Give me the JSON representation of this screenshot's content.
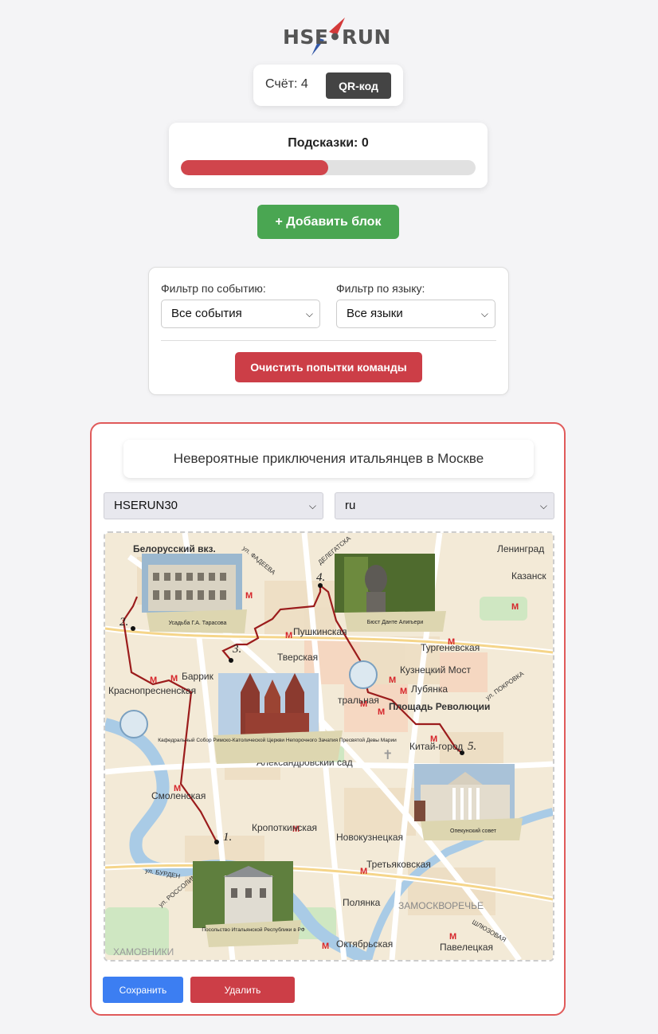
{
  "header": {
    "logo_text": "HSE•RUN"
  },
  "score": {
    "label": "Счёт: 4",
    "qr_button": "QR-код"
  },
  "hints": {
    "label": "Подсказки: 0",
    "progress_fraction": 0.5
  },
  "add_block_button": "+ Добавить блок",
  "filters": {
    "event_label": "Фильтр по событию:",
    "event_value": "Все события",
    "language_label": "Фильтр по языку:",
    "language_value": "Все языки",
    "clear_button": "Очистить попытки команды"
  },
  "block": {
    "title": "Невероятные приключения итальянцев в Москве",
    "event_select": "HSERUN30",
    "language_select": "ru",
    "save_button": "Сохранить",
    "delete_button": "Удалить",
    "map": {
      "station_labels": [
        "Белорусский вкз.",
        "Тверская",
        "Пушкинская",
        "Баррик",
        "Краснопресненская",
        "Смоленская",
        "Кропоткинская",
        "Александровский сад",
        "Китай-город",
        "Площадь Революции",
        "Лубянка",
        "Кузнецкий Мост",
        "Тургеневская",
        "Новокузнецкая",
        "Третьяковская",
        "Полянка",
        "Октябрьская",
        "Павелецкая",
        "ЗАМОСКВОРЕЧЬЕ",
        "ХАМОВНИКИ",
        "Ленинград",
        "Казанск",
        "тральная"
      ],
      "street_labels": [
        "ул. ФАДЕЕВА",
        "ДЕЛЕГАТСКА",
        "ул. ПОКРОВКА",
        "ул. БУРДЕН",
        "ул. РОССОЛИМ",
        "ШЛЮЗОВАЯ"
      ],
      "point_numbers": [
        "1.",
        "2.",
        "3.",
        "4.",
        "5."
      ],
      "photo_captions": [
        "Усадьба Г.А. Тарасова",
        "Бюст Данте Алигьери",
        "Кафедральный Собор Римско-Католической Церкви Непорочного Зачатия Пресвятой Девы Марии",
        "Опекунский совет",
        "Посольство Итальянской Республики в РФ"
      ]
    }
  },
  "colors": {
    "accent_red": "#cc3e47",
    "green": "#4aa652",
    "blue": "#3c7ef2",
    "route": "#9b1c1c"
  }
}
